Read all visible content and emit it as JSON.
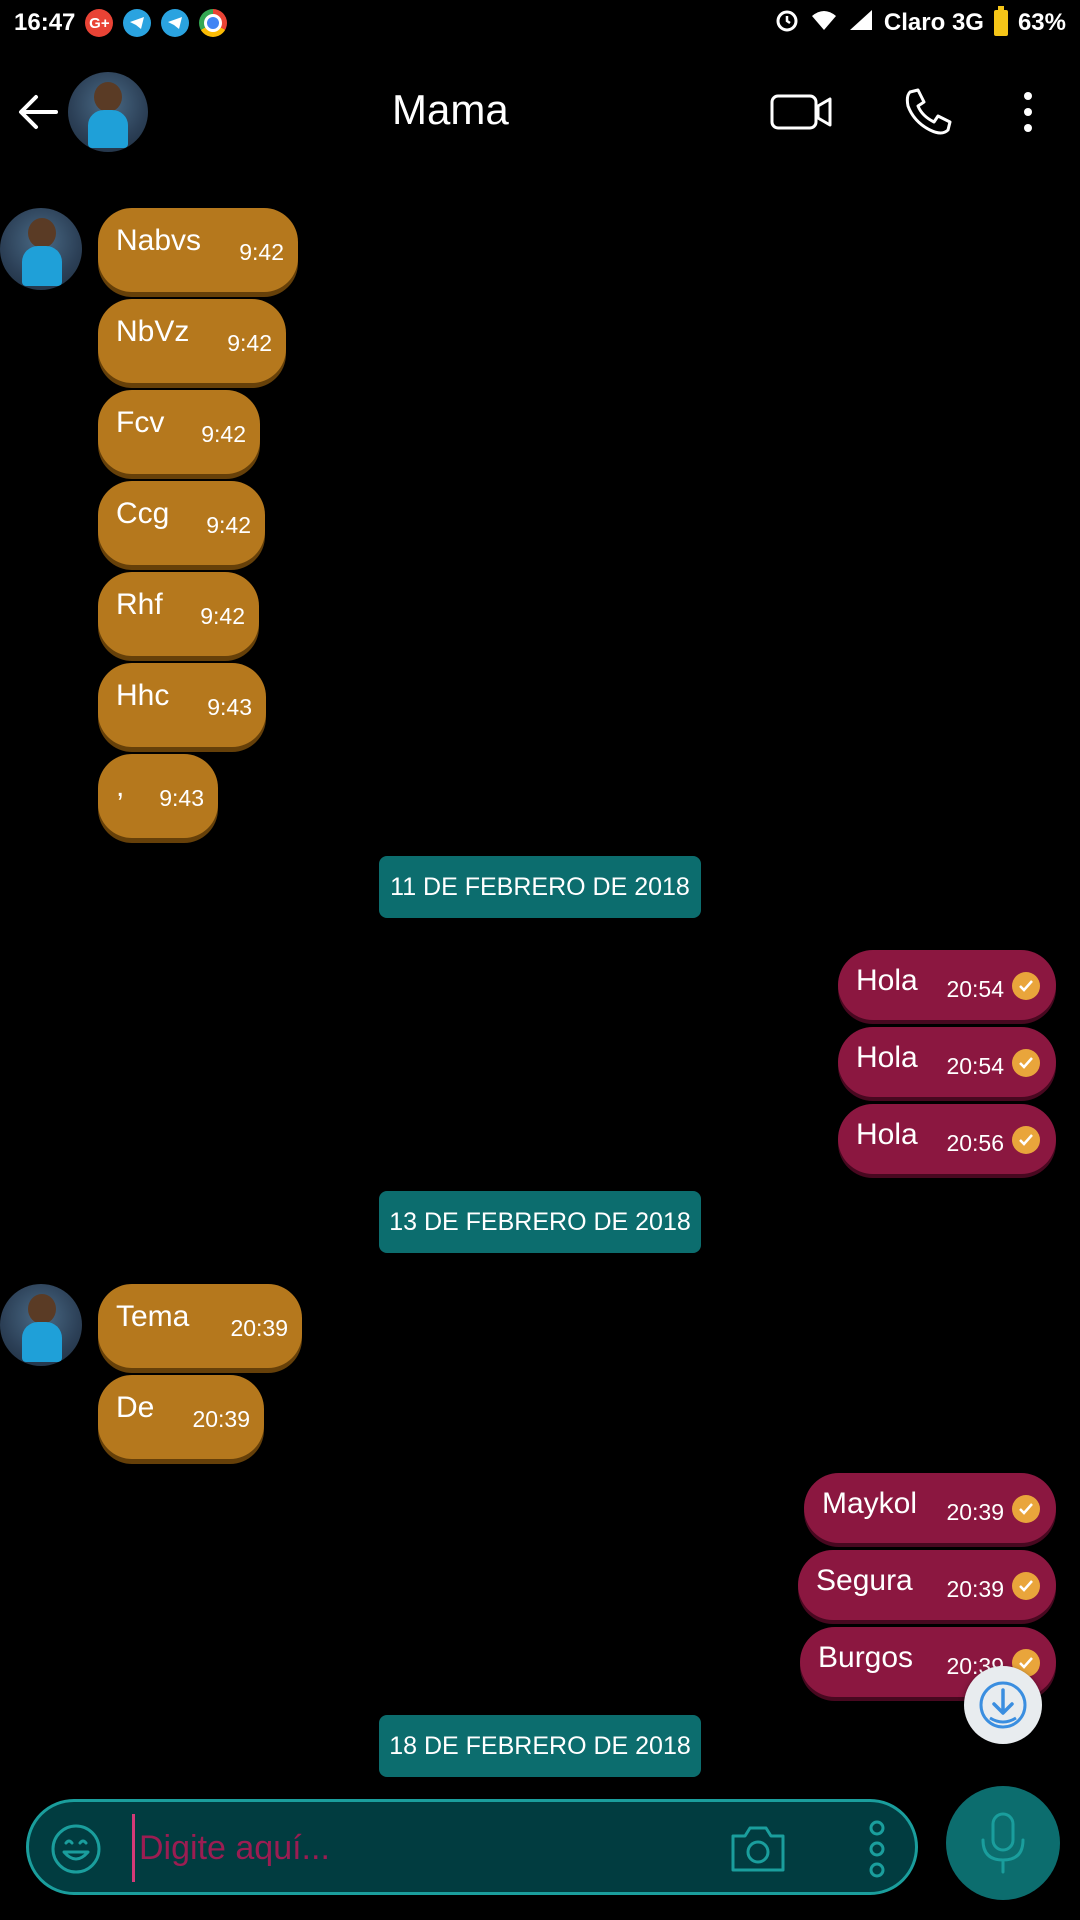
{
  "status_bar": {
    "time": "16:47",
    "notifications": [
      "google-plus-icon",
      "telegram-icon",
      "telegram-icon",
      "chrome-icon"
    ],
    "carrier": "Claro 3G",
    "battery": "63%"
  },
  "header": {
    "contact_name": "Mama"
  },
  "messages_group1": [
    {
      "text": "Nabvs",
      "time": "9:42"
    },
    {
      "text": "NbVz",
      "time": "9:42"
    },
    {
      "text": "Fcv",
      "time": "9:42"
    },
    {
      "text": "Ccg",
      "time": "9:42"
    },
    {
      "text": "Rhf",
      "time": "9:42"
    },
    {
      "text": "Hhc",
      "time": "9:43"
    },
    {
      "text": ",",
      "time": "9:43"
    }
  ],
  "date_1": "11 DE FEBRERO DE 2018",
  "messages_group2": [
    {
      "text": "Hola",
      "time": "20:54"
    },
    {
      "text": "Hola",
      "time": "20:54"
    },
    {
      "text": "Hola",
      "time": "20:56"
    }
  ],
  "date_2": "13 DE FEBRERO DE 2018",
  "messages_group3": [
    {
      "text": "Tema",
      "time": "20:39"
    },
    {
      "text": "De",
      "time": "20:39"
    }
  ],
  "messages_group4": [
    {
      "text": "Maykol",
      "time": "20:39"
    },
    {
      "text": "Segura",
      "time": "20:39"
    },
    {
      "text": "Burgos",
      "time": "20:39"
    }
  ],
  "date_3": "18 DE FEBRERO DE 2018",
  "composer": {
    "placeholder": "Digite aquí..."
  },
  "colors": {
    "incoming_bubble": "#b5781d",
    "outgoing_bubble": "#8b1740",
    "date_chip": "#0c6d6e",
    "accent": "#1a9e9d"
  }
}
